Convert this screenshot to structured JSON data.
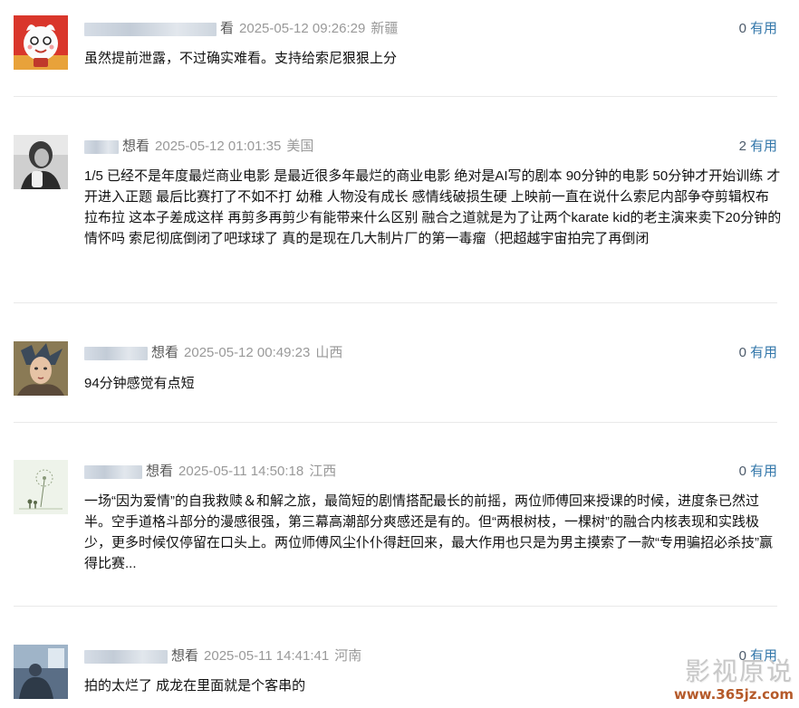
{
  "comments": [
    {
      "rating": "看",
      "time": "2025-05-12 09:26:29",
      "location": "新疆",
      "vote_count": "0",
      "vote_label": "有用",
      "text": "虽然提前泄露，不过确实难看。支持给索尼狠狠上分"
    },
    {
      "rating": "想看",
      "time": "2025-05-12 01:01:35",
      "location": "美国",
      "vote_count": "2",
      "vote_label": "有用",
      "text": "1/5 已经不是年度最烂商业电影 是最近很多年最烂的商业电影 绝对是AI写的剧本 90分钟的电影 50分钟才开始训练 才开进入正题 最后比赛打了不如不打 幼稚 人物没有成长 感情线破损生硬 上映前一直在说什么索尼内部争夺剪辑权布拉布拉 这本子差成这样 再剪多再剪少有能带来什么区别 融合之道就是为了让两个karate kid的老主演来卖下20分钟的情怀吗 索尼彻底倒闭了吧球球了 真的是现在几大制片厂的第一毒瘤（把超越宇宙拍完了再倒闭"
    },
    {
      "rating": "想看",
      "time": "2025-05-12 00:49:23",
      "location": "山西",
      "vote_count": "0",
      "vote_label": "有用",
      "text": "94分钟感觉有点短"
    },
    {
      "rating": "想看",
      "time": "2025-05-11 14:50:18",
      "location": "江西",
      "vote_count": "0",
      "vote_label": "有用",
      "text": "一场“因为爱情”的自我救赎＆和解之旅，最简短的剧情搭配最长的前摇，两位师傅回来授课的时候，进度条已然过半。空手道格斗部分的漫感很强，第三幕高潮部分爽感还是有的。但“两根树枝，一棵树”的融合内核表现和实践极少，更多时候仅停留在口头上。两位师傅风尘仆仆得赶回来，最大作用也只是为男主摸索了一款“专用骗招必杀技”赢得比赛..."
    },
    {
      "rating": "想看",
      "time": "2025-05-11 14:41:41",
      "location": "河南",
      "vote_count": "0",
      "vote_label": "有用",
      "text": "拍的太烂了 成龙在里面就是个客串的"
    }
  ],
  "watermark": {
    "title": "影视原说",
    "url": "www.365jz.com"
  }
}
